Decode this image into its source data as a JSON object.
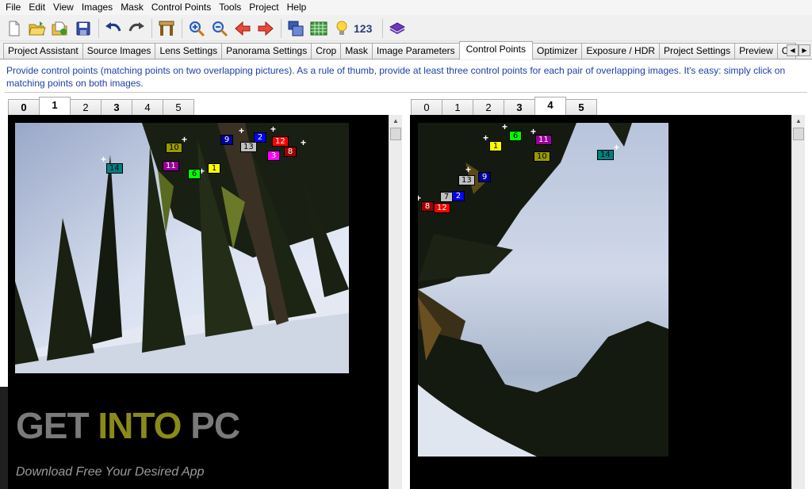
{
  "menu": [
    "File",
    "Edit",
    "View",
    "Images",
    "Mask",
    "Control Points",
    "Tools",
    "Project",
    "Help"
  ],
  "toolbar": {
    "icons": [
      "new-file-icon",
      "open-folder-icon",
      "open-recent-icon",
      "save-icon",
      "undo-icon",
      "redo-icon",
      "assistant-icon",
      "zoom-in-icon",
      "zoom-out-icon",
      "previous-icon",
      "next-icon",
      "copy-images-icon",
      "table-icon",
      "lightbulb-icon",
      "stack-icon"
    ],
    "number_label": "123"
  },
  "tabs": [
    {
      "label": "Project Assistant"
    },
    {
      "label": "Source Images"
    },
    {
      "label": "Lens Settings"
    },
    {
      "label": "Panorama Settings"
    },
    {
      "label": "Crop"
    },
    {
      "label": "Mask"
    },
    {
      "label": "Image Parameters"
    },
    {
      "label": "Control Points",
      "active": true
    },
    {
      "label": "Optimizer"
    },
    {
      "label": "Exposure / HDR"
    },
    {
      "label": "Project Settings"
    },
    {
      "label": "Preview"
    },
    {
      "label": "Cr"
    }
  ],
  "instructions": "Provide control points (matching points on two overlapping pictures). As a rule of thumb, provide at least three control points for each pair of overlapping images. It's easy: simply click on matching points on both images.",
  "left_image": {
    "tabs": [
      "0",
      "1",
      "2",
      "3",
      "4",
      "5"
    ],
    "active": "1",
    "points": [
      {
        "label": "9",
        "color": "#00009a",
        "text": "#ffffff"
      },
      {
        "label": "2",
        "color": "#0000ff",
        "text": "#ffffff"
      },
      {
        "label": "13",
        "color": "#c0c0c0",
        "text": "#000000"
      },
      {
        "label": "12",
        "color": "#ff0000",
        "text": "#ffffff"
      },
      {
        "label": "8",
        "color": "#a00000",
        "text": "#ffffff"
      },
      {
        "label": "3",
        "color": "#ff00ff",
        "text": "#ffffff"
      },
      {
        "label": "10",
        "color": "#9a9a00",
        "text": "#000000"
      },
      {
        "label": "11",
        "color": "#9a009a",
        "text": "#ffffff"
      },
      {
        "label": "6",
        "color": "#00ff00",
        "text": "#000000"
      },
      {
        "label": "1",
        "color": "#ffff00",
        "text": "#000000"
      },
      {
        "label": "14",
        "color": "#008080",
        "text": "#000000"
      }
    ]
  },
  "right_image": {
    "tabs": [
      "0",
      "1",
      "2",
      "3",
      "4",
      "5"
    ],
    "active": "4",
    "points": [
      {
        "label": "6",
        "color": "#00ff00",
        "text": "#000000"
      },
      {
        "label": "11",
        "color": "#9a009a",
        "text": "#ffffff"
      },
      {
        "label": "1",
        "color": "#ffff00",
        "text": "#000000"
      },
      {
        "label": "10",
        "color": "#9a9a00",
        "text": "#000000"
      },
      {
        "label": "14",
        "color": "#008080",
        "text": "#000000"
      },
      {
        "label": "13",
        "color": "#c0c0c0",
        "text": "#000000"
      },
      {
        "label": "9",
        "color": "#00009a",
        "text": "#ffffff"
      },
      {
        "label": "7",
        "color": "#c0c0c0",
        "text": "#000000"
      },
      {
        "label": "2",
        "color": "#0000ff",
        "text": "#ffffff"
      },
      {
        "label": "8",
        "color": "#a00000",
        "text": "#ffffff"
      },
      {
        "label": "12",
        "color": "#ff0000",
        "text": "#ffffff"
      }
    ]
  },
  "watermark": {
    "get": "GET",
    "into": "INTO",
    "pc": "PC",
    "subtitle": "Download Free Your Desired App"
  }
}
